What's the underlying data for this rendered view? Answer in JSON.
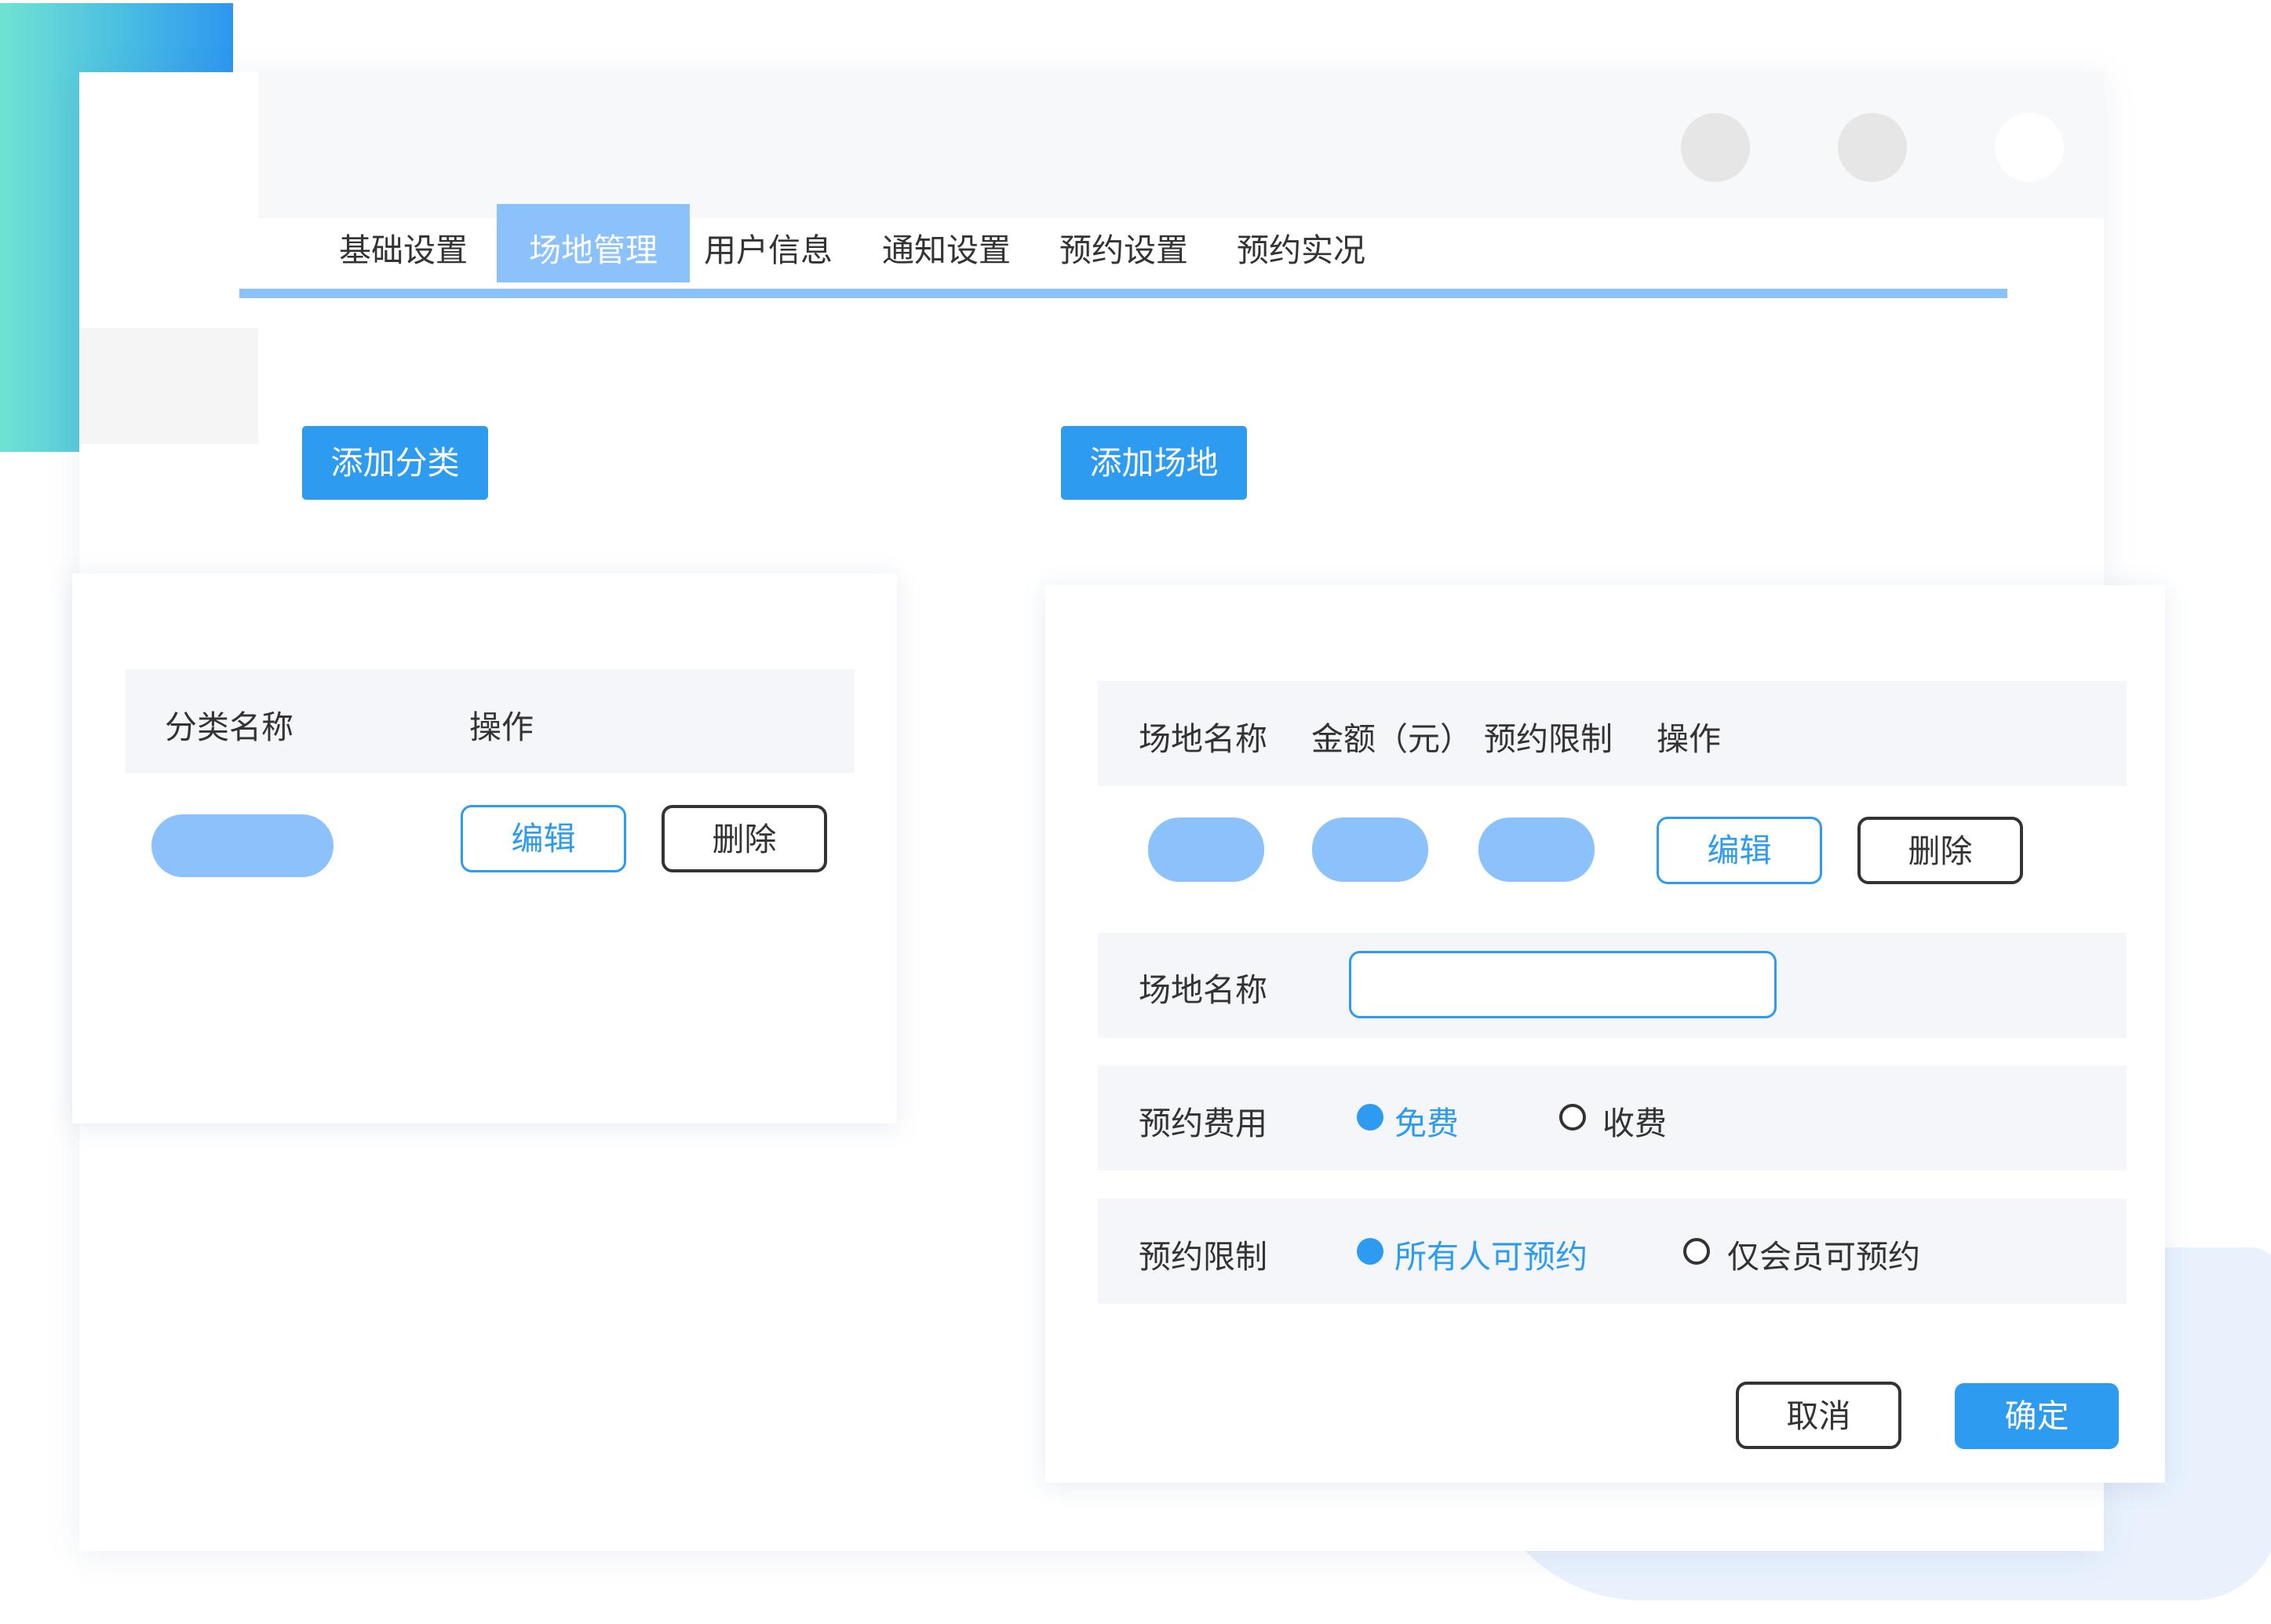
{
  "tabs": [
    {
      "label": "基础设置",
      "active": false
    },
    {
      "label": "场地管理",
      "active": true
    },
    {
      "label": "用户信息",
      "active": false
    },
    {
      "label": "通知设置",
      "active": false
    },
    {
      "label": "预约设置",
      "active": false
    },
    {
      "label": "预约实况",
      "active": false
    }
  ],
  "toolbar": {
    "add_category_label": "添加分类",
    "add_venue_label": "添加场地"
  },
  "category_panel": {
    "columns": [
      "分类名称",
      "操作"
    ],
    "edit_label": "编辑",
    "delete_label": "删除"
  },
  "venue_panel": {
    "columns": [
      "场地名称",
      "金额（元）",
      "预约限制",
      "操作"
    ],
    "edit_label": "编辑",
    "delete_label": "删除",
    "form": {
      "name_label": "场地名称",
      "name_value": "",
      "fee_label": "预约费用",
      "fee_options": [
        {
          "label": "免费",
          "selected": true
        },
        {
          "label": "收费",
          "selected": false
        }
      ],
      "limit_label": "预约限制",
      "limit_options": [
        {
          "label": "所有人可预约",
          "selected": true
        },
        {
          "label": "仅会员可预约",
          "selected": false
        }
      ]
    },
    "cancel_label": "取消",
    "confirm_label": "确定"
  },
  "colors": {
    "accent": "#2c9bf0",
    "accent_light": "#8cc2fb",
    "row_background": "#f5f6f9",
    "text": "#333333"
  }
}
